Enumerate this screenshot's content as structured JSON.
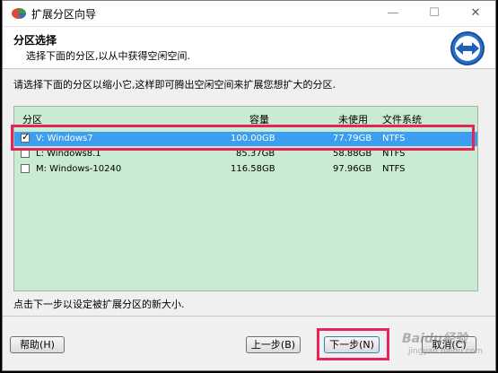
{
  "window": {
    "title": "扩展分区向导",
    "controls": {
      "minimize": "—",
      "maximize": "☐",
      "close": "✕"
    }
  },
  "header": {
    "title": "分区选择",
    "subtitle": "选择下面的分区,以从中获得空闲空间."
  },
  "instruction": "请选择下面的分区以缩小它,这样即可腾出空闲空间来扩展您想扩大的分区.",
  "table": {
    "columns": [
      "分区",
      "容量",
      "未使用",
      "文件系统"
    ],
    "rows": [
      {
        "name": "V: Windows7",
        "capacity": "100.00GB",
        "unused": "77.79GB",
        "fs": "NTFS",
        "checked": true,
        "selected": true
      },
      {
        "name": "L: Windows8.1",
        "capacity": "85.37GB",
        "unused": "58.88GB",
        "fs": "NTFS",
        "checked": false,
        "selected": false
      },
      {
        "name": "M: Windows-10240",
        "capacity": "116.58GB",
        "unused": "97.96GB",
        "fs": "NTFS",
        "checked": false,
        "selected": false
      }
    ],
    "checkmark": "✓"
  },
  "hint": "点击下一步以设定被扩展分区的新大小.",
  "buttons": {
    "help": "帮助(H)",
    "back": "上一步(B)",
    "next": "下一步(N)",
    "cancel": "取消(C)"
  },
  "watermark": {
    "main": "Baidu经验",
    "sub": "jingyan.baidu.com"
  },
  "colors": {
    "list_background": "#c8ebd1",
    "selected_row": "#3b9ef0",
    "annotation_highlight": "#e6245a"
  },
  "icons": {
    "app": "partition-app-icon",
    "header": "expand-arrows-icon"
  }
}
